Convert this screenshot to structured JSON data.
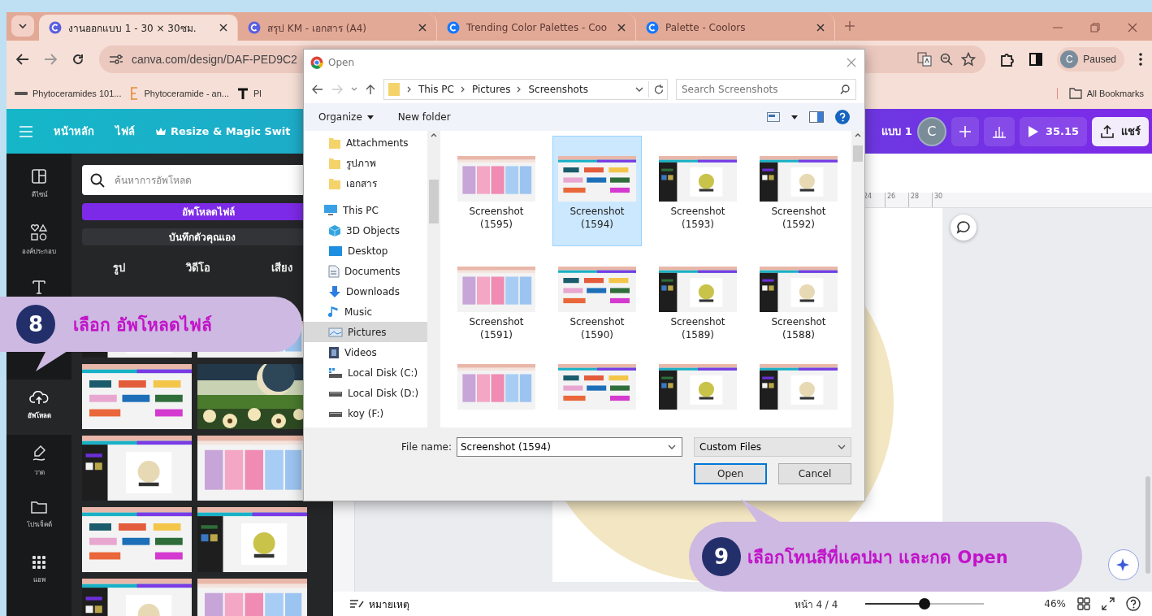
{
  "browser": {
    "tabs": [
      {
        "title": "งานออกแบบ 1 - 30 × 30ซม.",
        "selected": true
      },
      {
        "title": "สรุป KM - เอกสาร (A4)",
        "selected": false
      },
      {
        "title": "Trending Color Palettes - Coo",
        "selected": false
      },
      {
        "title": "Palette - Coolors",
        "selected": false
      }
    ],
    "address": "canva.com/design/DAF-PED9C2",
    "profile_initial": "C",
    "profile": "Paused",
    "bookmarks": [
      {
        "kind": "mbg",
        "title": "Phytoceramides 101..."
      },
      {
        "kind": "e",
        "title": "Phytoceramide - an..."
      },
      {
        "kind": "t",
        "title": "Pl"
      }
    ],
    "all_bookmarks": "All Bookmarks"
  },
  "canva": {
    "menu": [
      "หน้าหลัก",
      "ไฟล์",
      "Resize & Magic Swit"
    ],
    "doc_title": "แบบ 1",
    "avatar": "C",
    "timer": "35.15",
    "share": "แชร์",
    "rail": [
      {
        "kind": "design",
        "label": "ดีไซน์",
        "selected": false
      },
      {
        "kind": "elements",
        "label": "องค์ประกอบ",
        "selected": false
      },
      {
        "kind": "text",
        "selected": false
      },
      {
        "kind": "upload",
        "label": "อัพโหลด",
        "selected": true
      },
      {
        "kind": "draw",
        "label": "วาด",
        "selected": false
      },
      {
        "kind": "projects",
        "label": "โปรเจ็คต์",
        "selected": false
      },
      {
        "kind": "apps",
        "label": "แอพ",
        "selected": false
      }
    ],
    "search_placeholder": "ค้นหาการอัพโหลด",
    "upload_button": "อัพโหลดไฟล์",
    "record_button": "บันทึกตัวคุณเอง",
    "media_tabs": [
      "รูป",
      "วิดีโอ",
      "เสียง"
    ],
    "uploads": [
      {
        "kind": "picture"
      },
      {
        "kind": "picture"
      },
      {
        "kind": "picture"
      },
      {
        "kind": "picture"
      },
      {
        "kind": "picture"
      },
      {
        "kind": "picture"
      },
      {
        "kind": "picture"
      },
      {
        "kind": "picture"
      },
      {
        "kind": "picture"
      },
      {
        "kind": "picture"
      }
    ],
    "ruler": [
      "24",
      "26",
      "28",
      "30"
    ],
    "notes": "หมายเหตุ",
    "page": "หน้า 4 / 4",
    "zoom": {
      "level": 0.5
    },
    "zoom_reading": "46%"
  },
  "dialog": {
    "title": "Open",
    "path": [
      "This PC",
      "Pictures",
      "Screenshots"
    ],
    "search_placeholder": "Search Screenshots",
    "organize": "Organize",
    "new_folder": "New folder",
    "nav": [
      {
        "kind": "folder",
        "label": "Attachments",
        "selected": false
      },
      {
        "kind": "folder",
        "label": "รูปภาพ",
        "selected": false
      },
      {
        "kind": "folder",
        "label": "เอกสาร",
        "selected": false
      },
      {
        "kind": "pc",
        "label": "This PC",
        "selected": false
      },
      {
        "kind": "cube",
        "label": "3D Objects",
        "selected": false
      },
      {
        "kind": "desktop",
        "label": "Desktop",
        "selected": false
      },
      {
        "kind": "document",
        "label": "Documents",
        "selected": false
      },
      {
        "kind": "download",
        "label": "Downloads",
        "selected": false
      },
      {
        "kind": "music",
        "label": "Music",
        "selected": false
      },
      {
        "kind": "pictures",
        "label": "Pictures",
        "selected": true
      },
      {
        "kind": "video",
        "label": "Videos",
        "selected": false
      },
      {
        "kind": "disk",
        "label": "Local Disk (C:)",
        "selected": false
      },
      {
        "kind": "drive",
        "label": "Local Disk (D:)",
        "selected": false
      },
      {
        "kind": "drive",
        "label": "koy (F:)",
        "selected": false
      }
    ],
    "files": [
      {
        "name": "Screenshot (1595)",
        "selected": false
      },
      {
        "name": "Screenshot (1594)",
        "selected": true
      },
      {
        "name": "Screenshot (1593)",
        "selected": false
      },
      {
        "name": "Screenshot (1592)",
        "selected": false
      },
      {
        "name": "Screenshot (1591)",
        "selected": false
      },
      {
        "name": "Screenshot (1590)",
        "selected": false
      },
      {
        "name": "Screenshot (1589)",
        "selected": false
      },
      {
        "name": "Screenshot (1588)",
        "selected": false
      },
      {
        "selected": false
      },
      {
        "selected": false
      },
      {
        "selected": false
      },
      {
        "selected": false
      }
    ],
    "file_name_label": "File name:",
    "file_name": "Screenshot (1594)",
    "file_type": "Custom Files",
    "buttons": [
      "Open",
      "Cancel"
    ]
  },
  "callouts": [
    {
      "number": "8",
      "text": "เลือก อัพโหลดไฟล์"
    },
    {
      "number": "9",
      "text": "เลือกโทนสีที่แคปมา และกด  Open"
    }
  ]
}
